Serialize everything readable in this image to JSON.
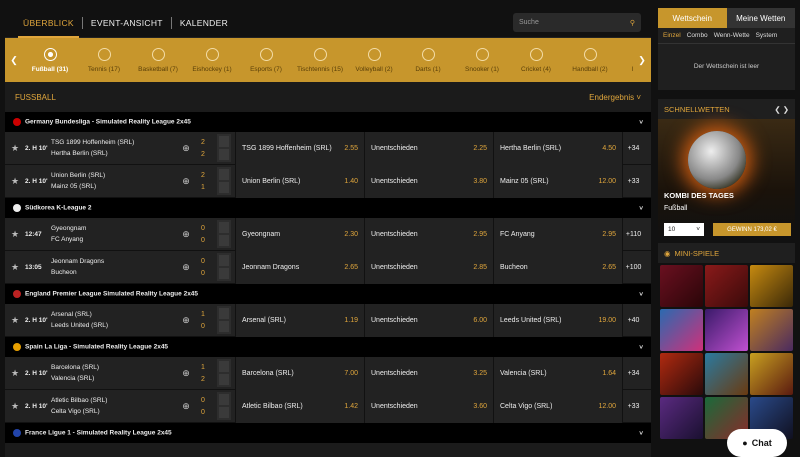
{
  "nav": {
    "tabs": [
      "ÜBERBLICK",
      "EVENT-ANSICHT",
      "KALENDER"
    ],
    "search_placeholder": "Suche"
  },
  "sports": [
    {
      "label": "Fußball (31)"
    },
    {
      "label": "Tennis (17)"
    },
    {
      "label": "Basketball (7)"
    },
    {
      "label": "Eishockey (1)"
    },
    {
      "label": "Esports (7)"
    },
    {
      "label": "Tischtennis (15)"
    },
    {
      "label": "Volleyball (2)"
    },
    {
      "label": "Darts (1)"
    },
    {
      "label": "Snooker (1)"
    },
    {
      "label": "Cricket (4)"
    },
    {
      "label": "Handball (2)"
    },
    {
      "label": "Federba"
    }
  ],
  "section": {
    "title": "FUSSBALL",
    "filter": "Endergebnis"
  },
  "leagues": [
    {
      "name": "Germany Bundesliga - Simulated Reality League 2x45",
      "flag": "#c00",
      "matches": [
        {
          "time": "2. H 10'",
          "home": "TSG 1899 Hoffenheim (SRL)",
          "away": "Hertha Berlin (SRL)",
          "sh": "2",
          "sa": "2",
          "o1l": "TSG 1899 Hoffenheim (SRL)",
          "o1": "2.55",
          "oxl": "Unentschieden",
          "ox": "2.25",
          "o2l": "Hertha Berlin (SRL)",
          "o2": "4.50",
          "more": "+34"
        },
        {
          "time": "2. H 10'",
          "home": "Union Berlin (SRL)",
          "away": "Mainz 05 (SRL)",
          "sh": "2",
          "sa": "1",
          "o1l": "Union Berlin (SRL)",
          "o1": "1.40",
          "oxl": "Unentschieden",
          "ox": "3.80",
          "o2l": "Mainz 05 (SRL)",
          "o2": "12.00",
          "more": "+33"
        }
      ]
    },
    {
      "name": "Südkorea K-League 2",
      "flag": "#eee",
      "matches": [
        {
          "time": "12:47",
          "home": "Gyeongnam",
          "away": "FC Anyang",
          "sh": "0",
          "sa": "0",
          "o1l": "Gyeongnam",
          "o1": "2.30",
          "oxl": "Unentschieden",
          "ox": "2.95",
          "o2l": "FC Anyang",
          "o2": "2.95",
          "more": "+110"
        },
        {
          "time": "13:05",
          "home": "Jeonnam Dragons",
          "away": "Bucheon",
          "sh": "0",
          "sa": "0",
          "o1l": "Jeonnam Dragons",
          "o1": "2.65",
          "oxl": "Unentschieden",
          "ox": "2.85",
          "o2l": "Bucheon",
          "o2": "2.65",
          "more": "+100"
        }
      ]
    },
    {
      "name": "England Premier League Simulated Reality League 2x45",
      "flag": "#b22",
      "matches": [
        {
          "time": "2. H 10'",
          "home": "Arsenal (SRL)",
          "away": "Leeds United (SRL)",
          "sh": "1",
          "sa": "0",
          "o1l": "Arsenal (SRL)",
          "o1": "1.19",
          "oxl": "Unentschieden",
          "ox": "6.00",
          "o2l": "Leeds United (SRL)",
          "o2": "19.00",
          "more": "+40"
        }
      ]
    },
    {
      "name": "Spain La Liga - Simulated Reality League 2x45",
      "flag": "#e8a000",
      "matches": [
        {
          "time": "2. H 10'",
          "home": "Barcelona (SRL)",
          "away": "Valencia (SRL)",
          "sh": "1",
          "sa": "2",
          "o1l": "Barcelona (SRL)",
          "o1": "7.00",
          "oxl": "Unentschieden",
          "ox": "3.25",
          "o2l": "Valencia (SRL)",
          "o2": "1.64",
          "more": "+34"
        },
        {
          "time": "2. H 10'",
          "home": "Atletic Bilbao (SRL)",
          "away": "Celta Vigo (SRL)",
          "sh": "0",
          "sa": "0",
          "o1l": "Atletic Bilbao (SRL)",
          "o1": "1.42",
          "oxl": "Unentschieden",
          "ox": "3.60",
          "o2l": "Celta Vigo (SRL)",
          "o2": "12.00",
          "more": "+33"
        }
      ]
    },
    {
      "name": "France Ligue 1 - Simulated Reality League 2x45",
      "flag": "#24a",
      "matches": []
    }
  ],
  "betslip": {
    "tab1": "Wettschein",
    "tab2": "Meine Wetten",
    "sub": [
      "Einzel",
      "Combo",
      "Wenn-Wette",
      "System"
    ],
    "empty": "Der Wettschein ist leer"
  },
  "quick": {
    "title": "SCHNELLWETTEN",
    "promo_title": "KOMBI DES TAGES",
    "promo_sub": "Fußball",
    "stake": "10",
    "win": "GEWINN 173,02 €"
  },
  "mini": {
    "title": "MINI-SPIELE"
  },
  "chat": "Chat"
}
